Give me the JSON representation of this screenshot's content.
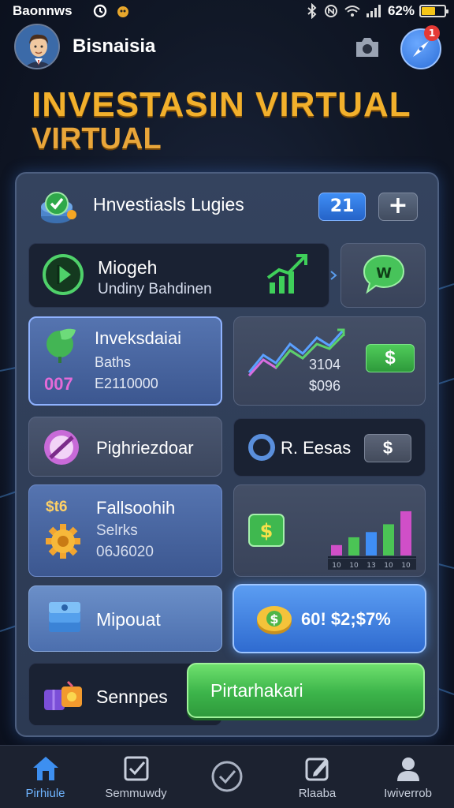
{
  "status_bar": {
    "carrier": "Baonnws",
    "battery_pct": "62%",
    "battery_level": 0.62,
    "battery_color": "#f5c518"
  },
  "header": {
    "user_name": "Bisnaisia",
    "notification_count": "1",
    "avatar_icon": "businessman-avatar-icon",
    "camera_icon": "camera-icon",
    "notification_icon": "compass-notification-icon"
  },
  "title": {
    "line1": "INVESTASIN VIRTUAL",
    "line2": "VIRTUAL",
    "color": "#f2b02c"
  },
  "panel": {
    "title": "Hnvestiasls Lugies",
    "count": "21",
    "add_label": "+"
  },
  "cards": {
    "mioget": {
      "title": "Miogeh",
      "subtitle": "Undiny Bahdinen"
    },
    "invest": {
      "title": "Inveksdaiai",
      "sub1": "Baths",
      "code": "007",
      "value": "E2110000"
    },
    "trend": {
      "value1": "3104",
      "value2": "$096",
      "badge": "$"
    },
    "pigh": {
      "title": "Pighriezdoar"
    },
    "eesas": {
      "title": "R. Eesas",
      "badge": "$"
    },
    "falls": {
      "icon_text": "$t6",
      "title": "Fallsoohih",
      "sub": "Selrks",
      "value": "06J6020"
    },
    "bars_chart": {
      "axis_labels": [
        "10",
        "10",
        "13",
        "10",
        "10"
      ],
      "bars": [
        0.2,
        0.35,
        0.45,
        0.6,
        0.85
      ],
      "bar_colors": [
        "#d04fc8",
        "#4bc455",
        "#3f8ef5",
        "#4bc455",
        "#d04fc8"
      ]
    },
    "mipouat": {
      "title": "Mipouat"
    },
    "amount": {
      "value": "60! $2;$7%"
    },
    "sennpes": {
      "title": "Sennpes"
    },
    "action": {
      "label": "Pirtarhakari"
    }
  },
  "bottom_nav": [
    {
      "label": "Pirhiule",
      "icon": "home-icon",
      "active": true
    },
    {
      "label": "Semmuwdy",
      "icon": "checkbox-icon",
      "active": false
    },
    {
      "label": "",
      "icon": "check-circle-icon",
      "active": false
    },
    {
      "label": "Rlaaba",
      "icon": "edit-icon",
      "active": false
    },
    {
      "label": "Iwiverrob",
      "icon": "user-icon",
      "active": false
    }
  ]
}
